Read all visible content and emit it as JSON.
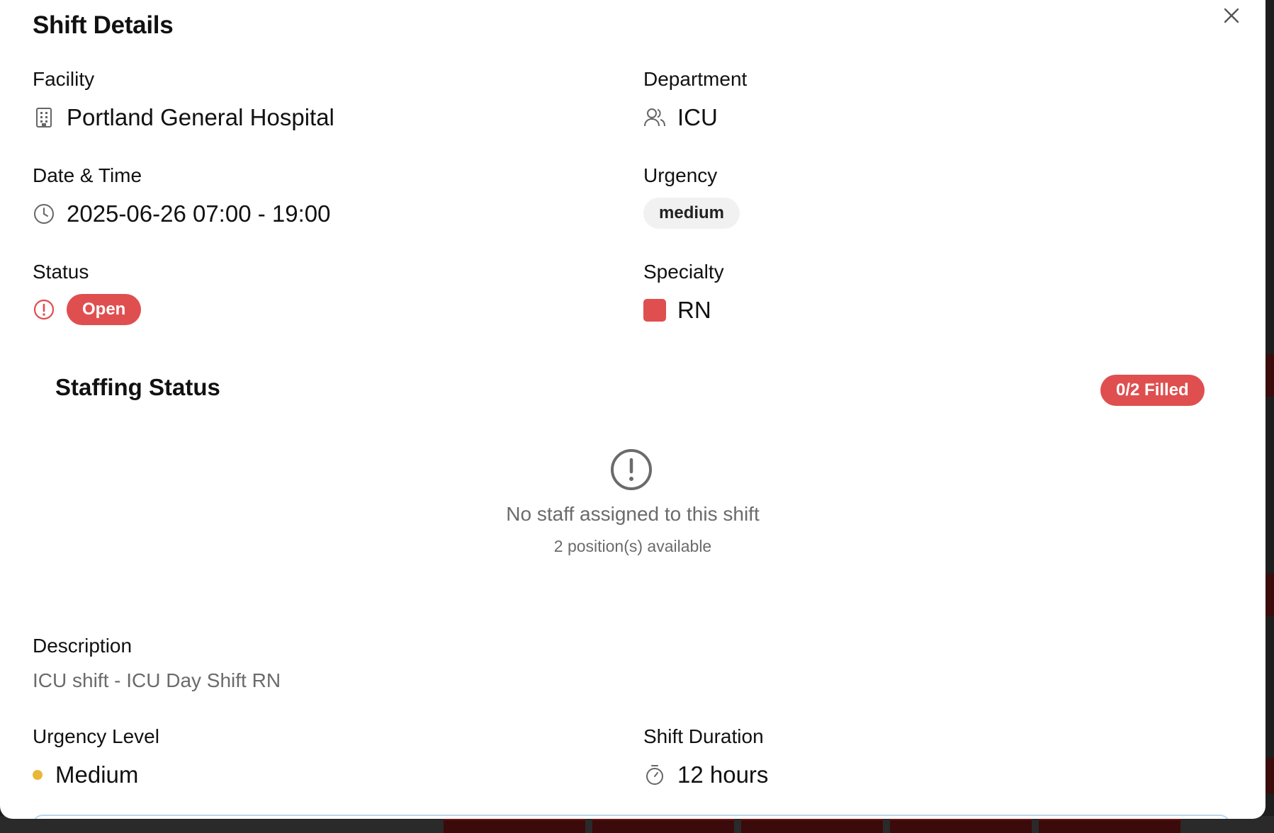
{
  "modal": {
    "title": "Shift Details",
    "close_icon": "close-icon"
  },
  "fields": {
    "facility": {
      "label": "Facility",
      "value": "Portland General Hospital",
      "icon": "building-icon"
    },
    "department": {
      "label": "Department",
      "value": "ICU",
      "icon": "users-icon"
    },
    "datetime": {
      "label": "Date & Time",
      "value": "2025-06-26 07:00 - 19:00",
      "icon": "clock-icon"
    },
    "urgency": {
      "label": "Urgency",
      "value": "medium"
    },
    "status": {
      "label": "Status",
      "value": "Open",
      "icon": "alert-circle-icon",
      "color": "#df4f4f"
    },
    "specialty": {
      "label": "Specialty",
      "value": "RN",
      "color": "#df4f4f"
    }
  },
  "staffing": {
    "title": "Staffing Status",
    "badge": "0/2 Filled",
    "badge_color": "#df4f4f",
    "empty_title": "No staff assigned to this shift",
    "empty_subtitle": "2 position(s) available"
  },
  "description": {
    "label": "Description",
    "text": "ICU shift - ICU Day Shift RN"
  },
  "urgency_level": {
    "label": "Urgency Level",
    "value": "Medium",
    "color": "#e8b73a"
  },
  "shift_duration": {
    "label": "Shift Duration",
    "value": "12 hours",
    "icon": "timer-icon"
  }
}
